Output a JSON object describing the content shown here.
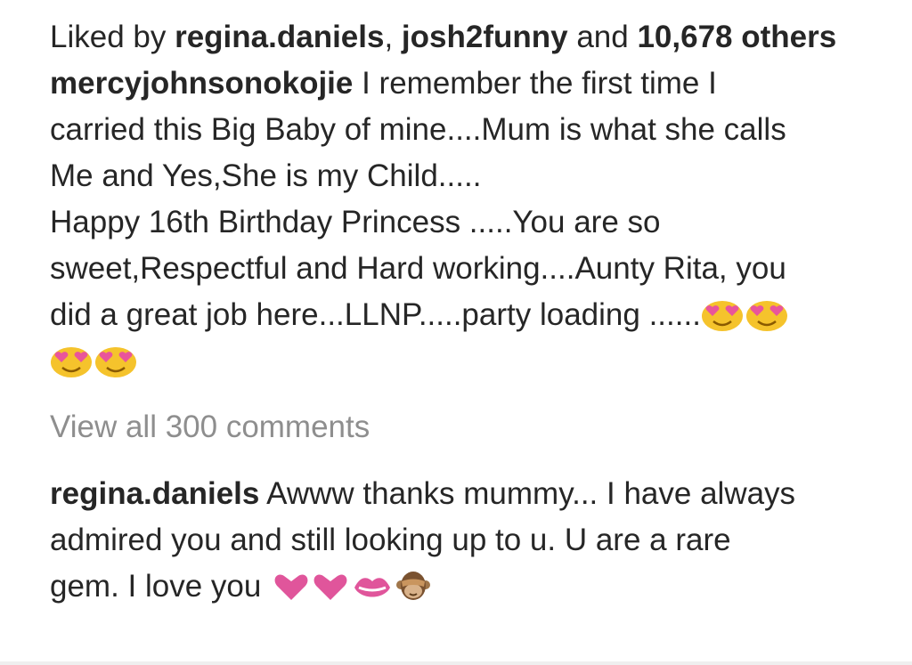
{
  "likes": {
    "prefix": "Liked by ",
    "user1": "regina.daniels",
    "separator": ", ",
    "user2": "josh2funny",
    "and_text": " and ",
    "count": "10,678",
    "others": "others"
  },
  "caption": {
    "username": "mercyjohnsonokojie",
    "line1": " I remember the first time I",
    "line2": "carried this Big Baby of mine....Mum is what she calls",
    "line3": "Me and Yes,She is my Child.....",
    "line4": "Happy 16th Birthday Princess .....You are so",
    "line5": "sweet,Respectful and Hard working....Aunty Rita, you",
    "line6": "did a great job here...LLNP.....party loading ......",
    "emoji_name": "heart-eyes-face-icon"
  },
  "view_all_comments": "View all 300 comments",
  "comment": {
    "username": "regina.daniels",
    "line1": " Awww thanks mummy... I have always",
    "line2": "admired you and still looking up to u. U are a rare",
    "line3": "gem. I love you ",
    "emojis": [
      "heart-icon",
      "heart-icon",
      "kiss-mark-icon",
      "see-no-evil-monkey-icon"
    ]
  },
  "colors": {
    "text": "#262626",
    "muted": "#8e8e8e",
    "heart": "#e0559b"
  }
}
